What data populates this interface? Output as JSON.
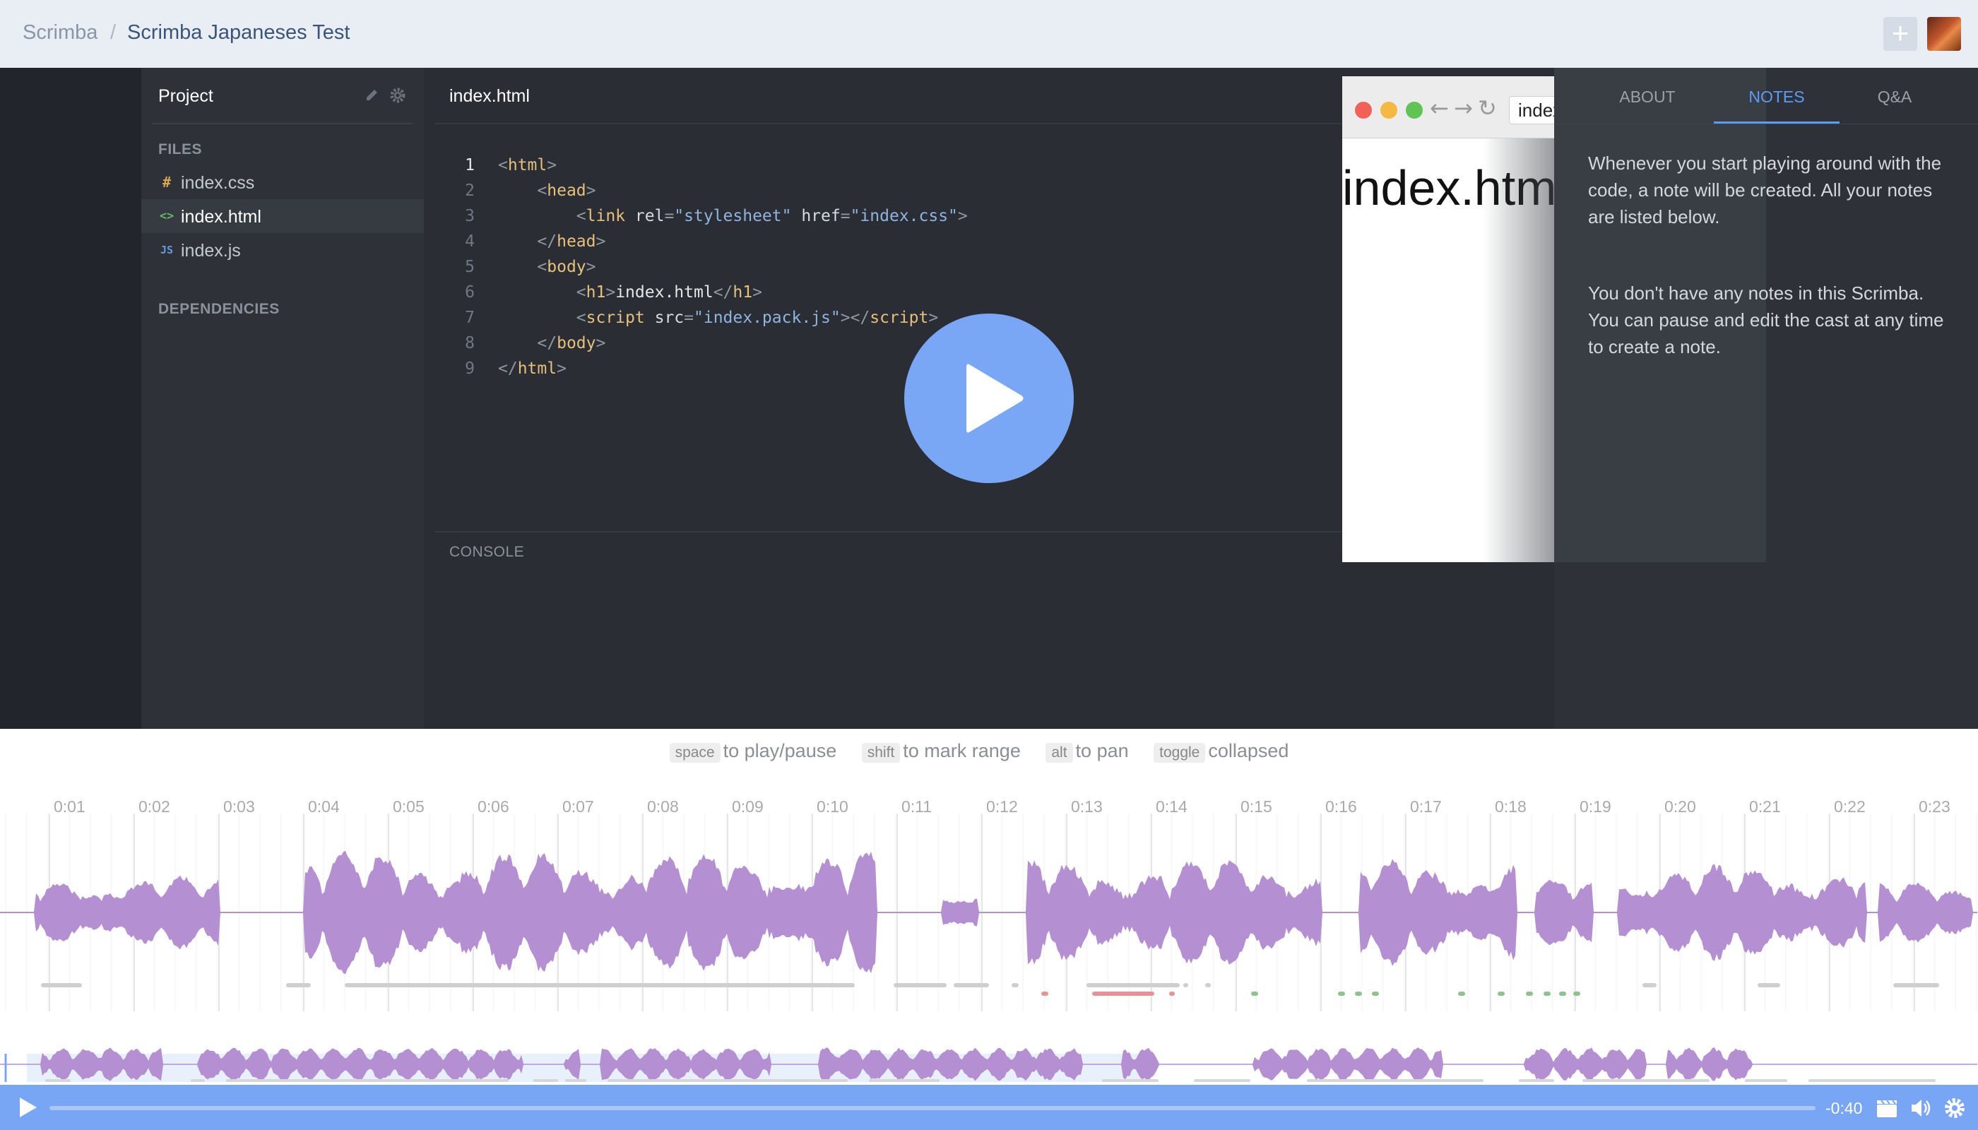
{
  "breadcrumb": {
    "root": "Scrimba",
    "separator": "/",
    "title": "Scrimba Japaneses Test"
  },
  "sidebar": {
    "title": "Project",
    "files_heading": "FILES",
    "files": [
      {
        "icon_text": "#",
        "icon_color": "#d9a84e",
        "label": "index.css"
      },
      {
        "icon_text": "<>",
        "icon_color": "#69b36a",
        "label": "index.html",
        "active": true
      },
      {
        "icon_text": "JS",
        "icon_color": "#6a98d6",
        "label": "index.js"
      }
    ],
    "dependencies_heading": "DEPENDENCIES"
  },
  "editor": {
    "tab": "index.html",
    "line_numbers": [
      "1",
      "2",
      "3",
      "4",
      "5",
      "6",
      "7",
      "8",
      "9"
    ],
    "console_label": "CONSOLE"
  },
  "preview": {
    "url": "index.html",
    "heading": "index.html"
  },
  "right_panel": {
    "tabs": [
      "ABOUT",
      "NOTES",
      "Q&A"
    ],
    "active_tab": "NOTES",
    "note_intro": "Whenever you start playing around with the code, a note will be created. All your notes are listed below.",
    "empty_message": "You don't have any notes in this Scrimba. You can pause and edit the cast at any time to create a note."
  },
  "timeline": {
    "hints": [
      {
        "key": "space",
        "text": "to play/pause"
      },
      {
        "key": "shift",
        "text": "to mark range"
      },
      {
        "key": "alt",
        "text": "to pan"
      },
      {
        "key": "toggle",
        "text": "collapsed"
      }
    ],
    "ticks": [
      "0:01",
      "0:02",
      "0:03",
      "0:04",
      "0:05",
      "0:06",
      "0:07",
      "0:08",
      "0:09",
      "0:10",
      "0:11",
      "0:12",
      "0:13",
      "0:14",
      "0:15",
      "0:16",
      "0:17",
      "0:18",
      "0:19",
      "0:20",
      "0:21",
      "0:22",
      "0:23"
    ],
    "waveform_color": "#b48fd1"
  },
  "player": {
    "time_remaining": "-0:40",
    "accent": "#78a6f5"
  }
}
